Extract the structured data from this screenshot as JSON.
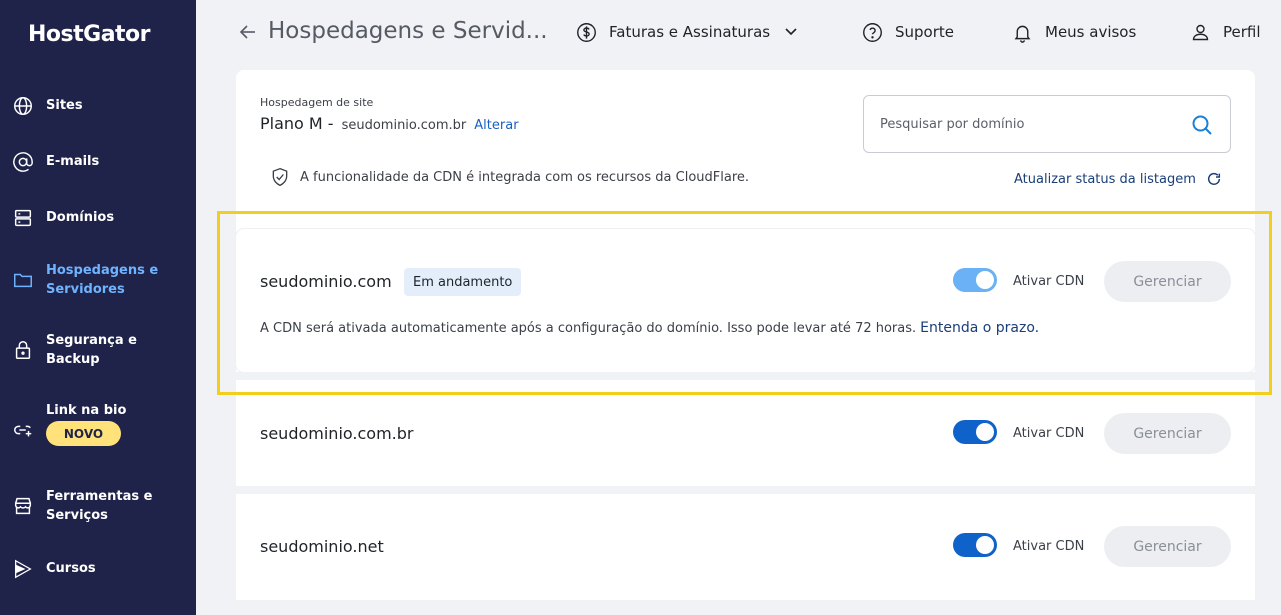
{
  "sidebar": {
    "logo": "HostGator",
    "items": [
      {
        "label": "Sites",
        "icon": "globe-icon"
      },
      {
        "label": "E-mails",
        "icon": "at-icon"
      },
      {
        "label": "Domínios",
        "icon": "server-icon"
      },
      {
        "label": "Hospedagens e Servidores",
        "icon": "folder-icon",
        "active": true
      },
      {
        "label": "Segurança e Backup",
        "icon": "lock-icon"
      },
      {
        "label": "Link na bio",
        "icon": "link-plus-icon",
        "badge": "NOVO"
      },
      {
        "label": "Ferramentas e Serviços",
        "icon": "store-icon"
      },
      {
        "label": "Cursos",
        "icon": "play-icon"
      }
    ]
  },
  "header": {
    "title": "Hospedagens e Servid...",
    "nav": {
      "billing": "Faturas e Assinaturas",
      "support": "Suporte",
      "notices": "Meus avisos",
      "profile": "Perfil"
    }
  },
  "hosting": {
    "label": "Hospedagem de site",
    "plan": "Plano M -",
    "domain": "seudominio.com.br",
    "change_link": "Alterar"
  },
  "search": {
    "placeholder": "Pesquisar por domínio"
  },
  "cdn_note": "A funcionalidade da CDN é integrada com os recursos da CloudFlare.",
  "refresh_link": "Atualizar status da listagem",
  "domains": [
    {
      "name": "seudominio.com",
      "status": "Em andamento",
      "toggle_label": "Ativar CDN",
      "manage_label": "Gerenciar",
      "message": "A CDN será ativada automaticamente após a configuração do domínio. Isso pode levar até 72 horas.",
      "message_link": "Entenda o prazo."
    },
    {
      "name": "seudominio.com.br",
      "toggle_label": "Ativar CDN",
      "manage_label": "Gerenciar"
    },
    {
      "name": "seudominio.net",
      "toggle_label": "Ativar CDN",
      "manage_label": "Gerenciar"
    }
  ],
  "colors": {
    "sidebar_bg": "#1f2349",
    "active_nav": "#6fb3ff",
    "badge_novo": "#ffe27a",
    "toggle_on": "#0f62c9",
    "toggle_pending": "#6ab1f5",
    "highlight": "#f2cf1f"
  }
}
